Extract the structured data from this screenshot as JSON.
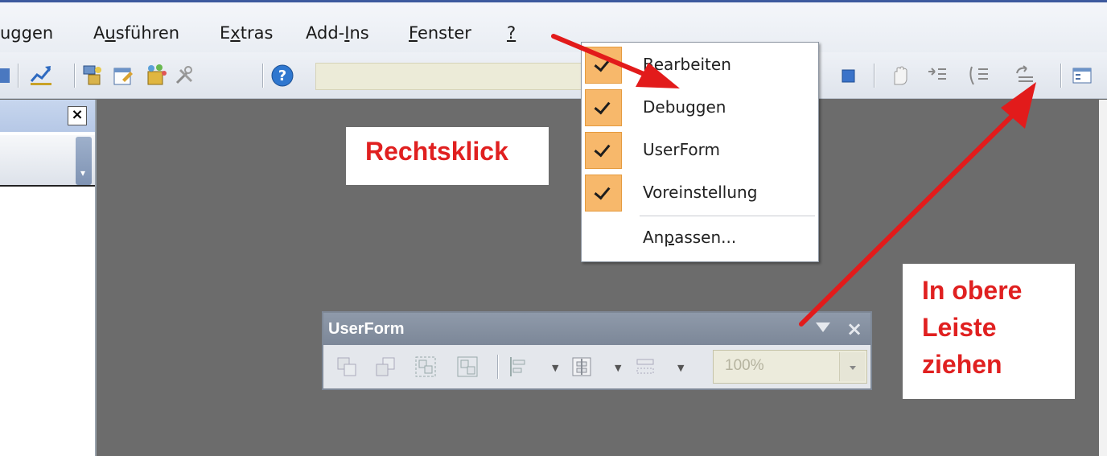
{
  "menubar": {
    "items": [
      {
        "label": "uggen"
      },
      {
        "label": "Ausführen",
        "access_key": "u"
      },
      {
        "label": "Extras",
        "access_key": "x"
      },
      {
        "label": "Add-Ins",
        "access_key": "I"
      },
      {
        "label": "Fenster",
        "access_key": "F"
      },
      {
        "label": "?",
        "access_key": "?"
      }
    ]
  },
  "toolbar": {
    "icons": [
      "design-mode-icon",
      "project-explorer-icon",
      "properties-icon",
      "object-browser-icon",
      "toolbox-icon",
      "help-icon",
      "reset-icon",
      "toggle-breakpoint-icon",
      "step-into-icon",
      "step-over-icon",
      "step-out-icon",
      "locals-window-icon"
    ]
  },
  "left_panel": {
    "close_label": "×"
  },
  "context_menu": {
    "items": [
      {
        "label": "Bearbeiten",
        "checked": true
      },
      {
        "label": "Debuggen",
        "checked": true
      },
      {
        "label": "UserForm",
        "checked": true
      },
      {
        "label": "Voreinstellung",
        "checked": true
      }
    ],
    "customize_label": "Anpassen..."
  },
  "annotations": {
    "right_click": "Rechtsklick",
    "drag_lines": [
      "In obere",
      "Leiste",
      "ziehen"
    ]
  },
  "userform_toolbar": {
    "title": "UserForm",
    "close_label": "×",
    "zoom_value": "100%"
  },
  "colors": {
    "annotation_text": "#e02020",
    "check_highlight": "#f7b86b",
    "workspace": "#6c6c6c",
    "arrow": "#e21b1b"
  }
}
